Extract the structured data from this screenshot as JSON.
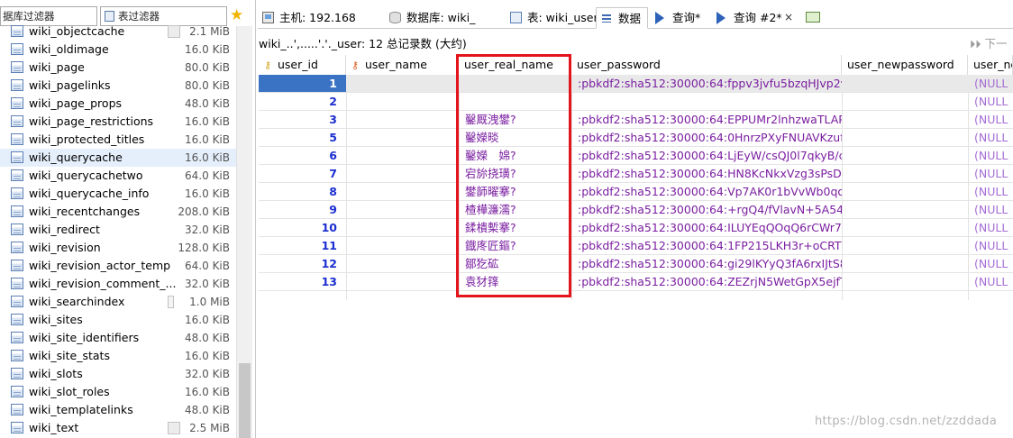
{
  "left_panel": {
    "db_filter": "据库过滤器",
    "table_filter": "表过滤器",
    "tables": [
      {
        "name": "wiki_objectcache",
        "size": "2.1 MiB",
        "bar": true
      },
      {
        "name": "wiki_oldimage",
        "size": "16.0 KiB"
      },
      {
        "name": "wiki_page",
        "size": "80.0 KiB"
      },
      {
        "name": "wiki_pagelinks",
        "size": "80.0 KiB"
      },
      {
        "name": "wiki_page_props",
        "size": "48.0 KiB"
      },
      {
        "name": "wiki_page_restrictions",
        "size": "16.0 KiB"
      },
      {
        "name": "wiki_protected_titles",
        "size": "16.0 KiB"
      },
      {
        "name": "wiki_querycache",
        "size": "16.0 KiB"
      },
      {
        "name": "wiki_querycachetwo",
        "size": "64.0 KiB"
      },
      {
        "name": "wiki_querycache_info",
        "size": "16.0 KiB"
      },
      {
        "name": "wiki_recentchanges",
        "size": "208.0 KiB"
      },
      {
        "name": "wiki_redirect",
        "size": "32.0 KiB"
      },
      {
        "name": "wiki_revision",
        "size": "128.0 KiB"
      },
      {
        "name": "wiki_revision_actor_temp",
        "size": "64.0 KiB"
      },
      {
        "name": "wiki_revision_comment_...",
        "size": "32.0 KiB"
      },
      {
        "name": "wiki_searchindex",
        "size": "1.0 MiB",
        "bar": "thin"
      },
      {
        "name": "wiki_sites",
        "size": "16.0 KiB"
      },
      {
        "name": "wiki_site_identifiers",
        "size": "48.0 KiB"
      },
      {
        "name": "wiki_site_stats",
        "size": "16.0 KiB"
      },
      {
        "name": "wiki_slots",
        "size": "32.0 KiB"
      },
      {
        "name": "wiki_slot_roles",
        "size": "16.0 KiB"
      },
      {
        "name": "wiki_templatelinks",
        "size": "48.0 KiB"
      },
      {
        "name": "wiki_text",
        "size": "2.5 MiB",
        "bar": true
      }
    ],
    "selected_index": 7
  },
  "tabs": [
    {
      "label": "主机: 192.168",
      "icon": "host-icon"
    },
    {
      "label": "数据库: wiki_",
      "icon": "database-icon"
    },
    {
      "label": "表: wiki_user",
      "icon": "table-icon"
    },
    {
      "label": "数据",
      "icon": "data-grid-icon",
      "active": true
    },
    {
      "label": "查询*",
      "icon": "query-play-icon"
    },
    {
      "label": "查询 #2*",
      "icon": "query-play-icon",
      "closable": true,
      "close_glyph": "×"
    }
  ],
  "info_line": "wiki_..',.....'.'._user: 12 总记录数 (大约)",
  "next_button": "下一",
  "columns": [
    {
      "label": "user_id",
      "key": "primary"
    },
    {
      "label": "user_name",
      "key": "unique"
    },
    {
      "label": "user_real_name"
    },
    {
      "label": "user_password"
    },
    {
      "label": "user_newpassword"
    },
    {
      "label": "user_ne"
    }
  ],
  "rows": [
    {
      "id": "1",
      "name": "",
      "real": "",
      "password": ":pbkdf2:sha512:30000:64:fppv3jvfu5bzqHJvp2v...",
      "newpassword": "",
      "ne": "(NULL"
    },
    {
      "id": "2",
      "name": "",
      "real": "",
      "password": "",
      "newpassword": "",
      "ne": "(NULL"
    },
    {
      "id": "3",
      "name": "",
      "real": "鑿厩洩鐢?",
      "password": ":pbkdf2:sha512:30000:64:EPPUMr2lnhzwaTLAPs...",
      "newpassword": "",
      "ne": "(NULL"
    },
    {
      "id": "5",
      "name": "",
      "real": "鑿嬫晱",
      "password": ":pbkdf2:sha512:30000:64:0HnrzPXyFNUAVKzuf...",
      "newpassword": "",
      "ne": "(NULL"
    },
    {
      "id": "6",
      "name": "",
      "real": "鑿嬫　婂?",
      "password": ":pbkdf2:sha512:30000:64:LjEyW/csQJ0l7qkyB/cl...",
      "newpassword": "",
      "ne": "(NULL"
    },
    {
      "id": "7",
      "name": "",
      "real": "宕旀挠璜?",
      "password": ":pbkdf2:sha512:30000:64:HN8KcNkxVzg3sPsDn...",
      "newpassword": "",
      "ne": "(NULL"
    },
    {
      "id": "8",
      "name": "",
      "real": "鐢韴曜搴?",
      "password": ":pbkdf2:sha512:30000:64:Vp7AK0r1bVvWb0qo...",
      "newpassword": "",
      "ne": "(NULL"
    },
    {
      "id": "9",
      "name": "",
      "real": "楂樺濂濡?",
      "password": ":pbkdf2:sha512:30000:64:+rgQ4/fVlavN+5A54f...",
      "newpassword": "",
      "ne": "(NULL"
    },
    {
      "id": "10",
      "name": "",
      "real": "鍒樻槧搴?",
      "password": ":pbkdf2:sha512:30000:64:ILUYEqQOqQ6rCWr7...",
      "newpassword": "",
      "ne": "(NULL"
    },
    {
      "id": "11",
      "name": "",
      "real": "鐡庝匠鏂?",
      "password": ":pbkdf2:sha512:30000:64:1FP215LKH3r+oCRTv0...",
      "newpassword": "",
      "ne": "(NULL"
    },
    {
      "id": "12",
      "name": "",
      "real": "鄒犵砿",
      "password": ":pbkdf2:sha512:30000:64:gi29lKYyQ3fA6rxIJtS8j...",
      "newpassword": "",
      "ne": "(NULL"
    },
    {
      "id": "13",
      "name": "",
      "real": "袁犲箨",
      "password": ":pbkdf2:sha512:30000:64:ZEZrjN5WetGpX5ejfT...",
      "newpassword": "",
      "ne": "(NULL"
    }
  ],
  "selected_row": 0,
  "highlight_color": "#e3141b",
  "watermark": "https://blog.csdn.net/zzddada"
}
